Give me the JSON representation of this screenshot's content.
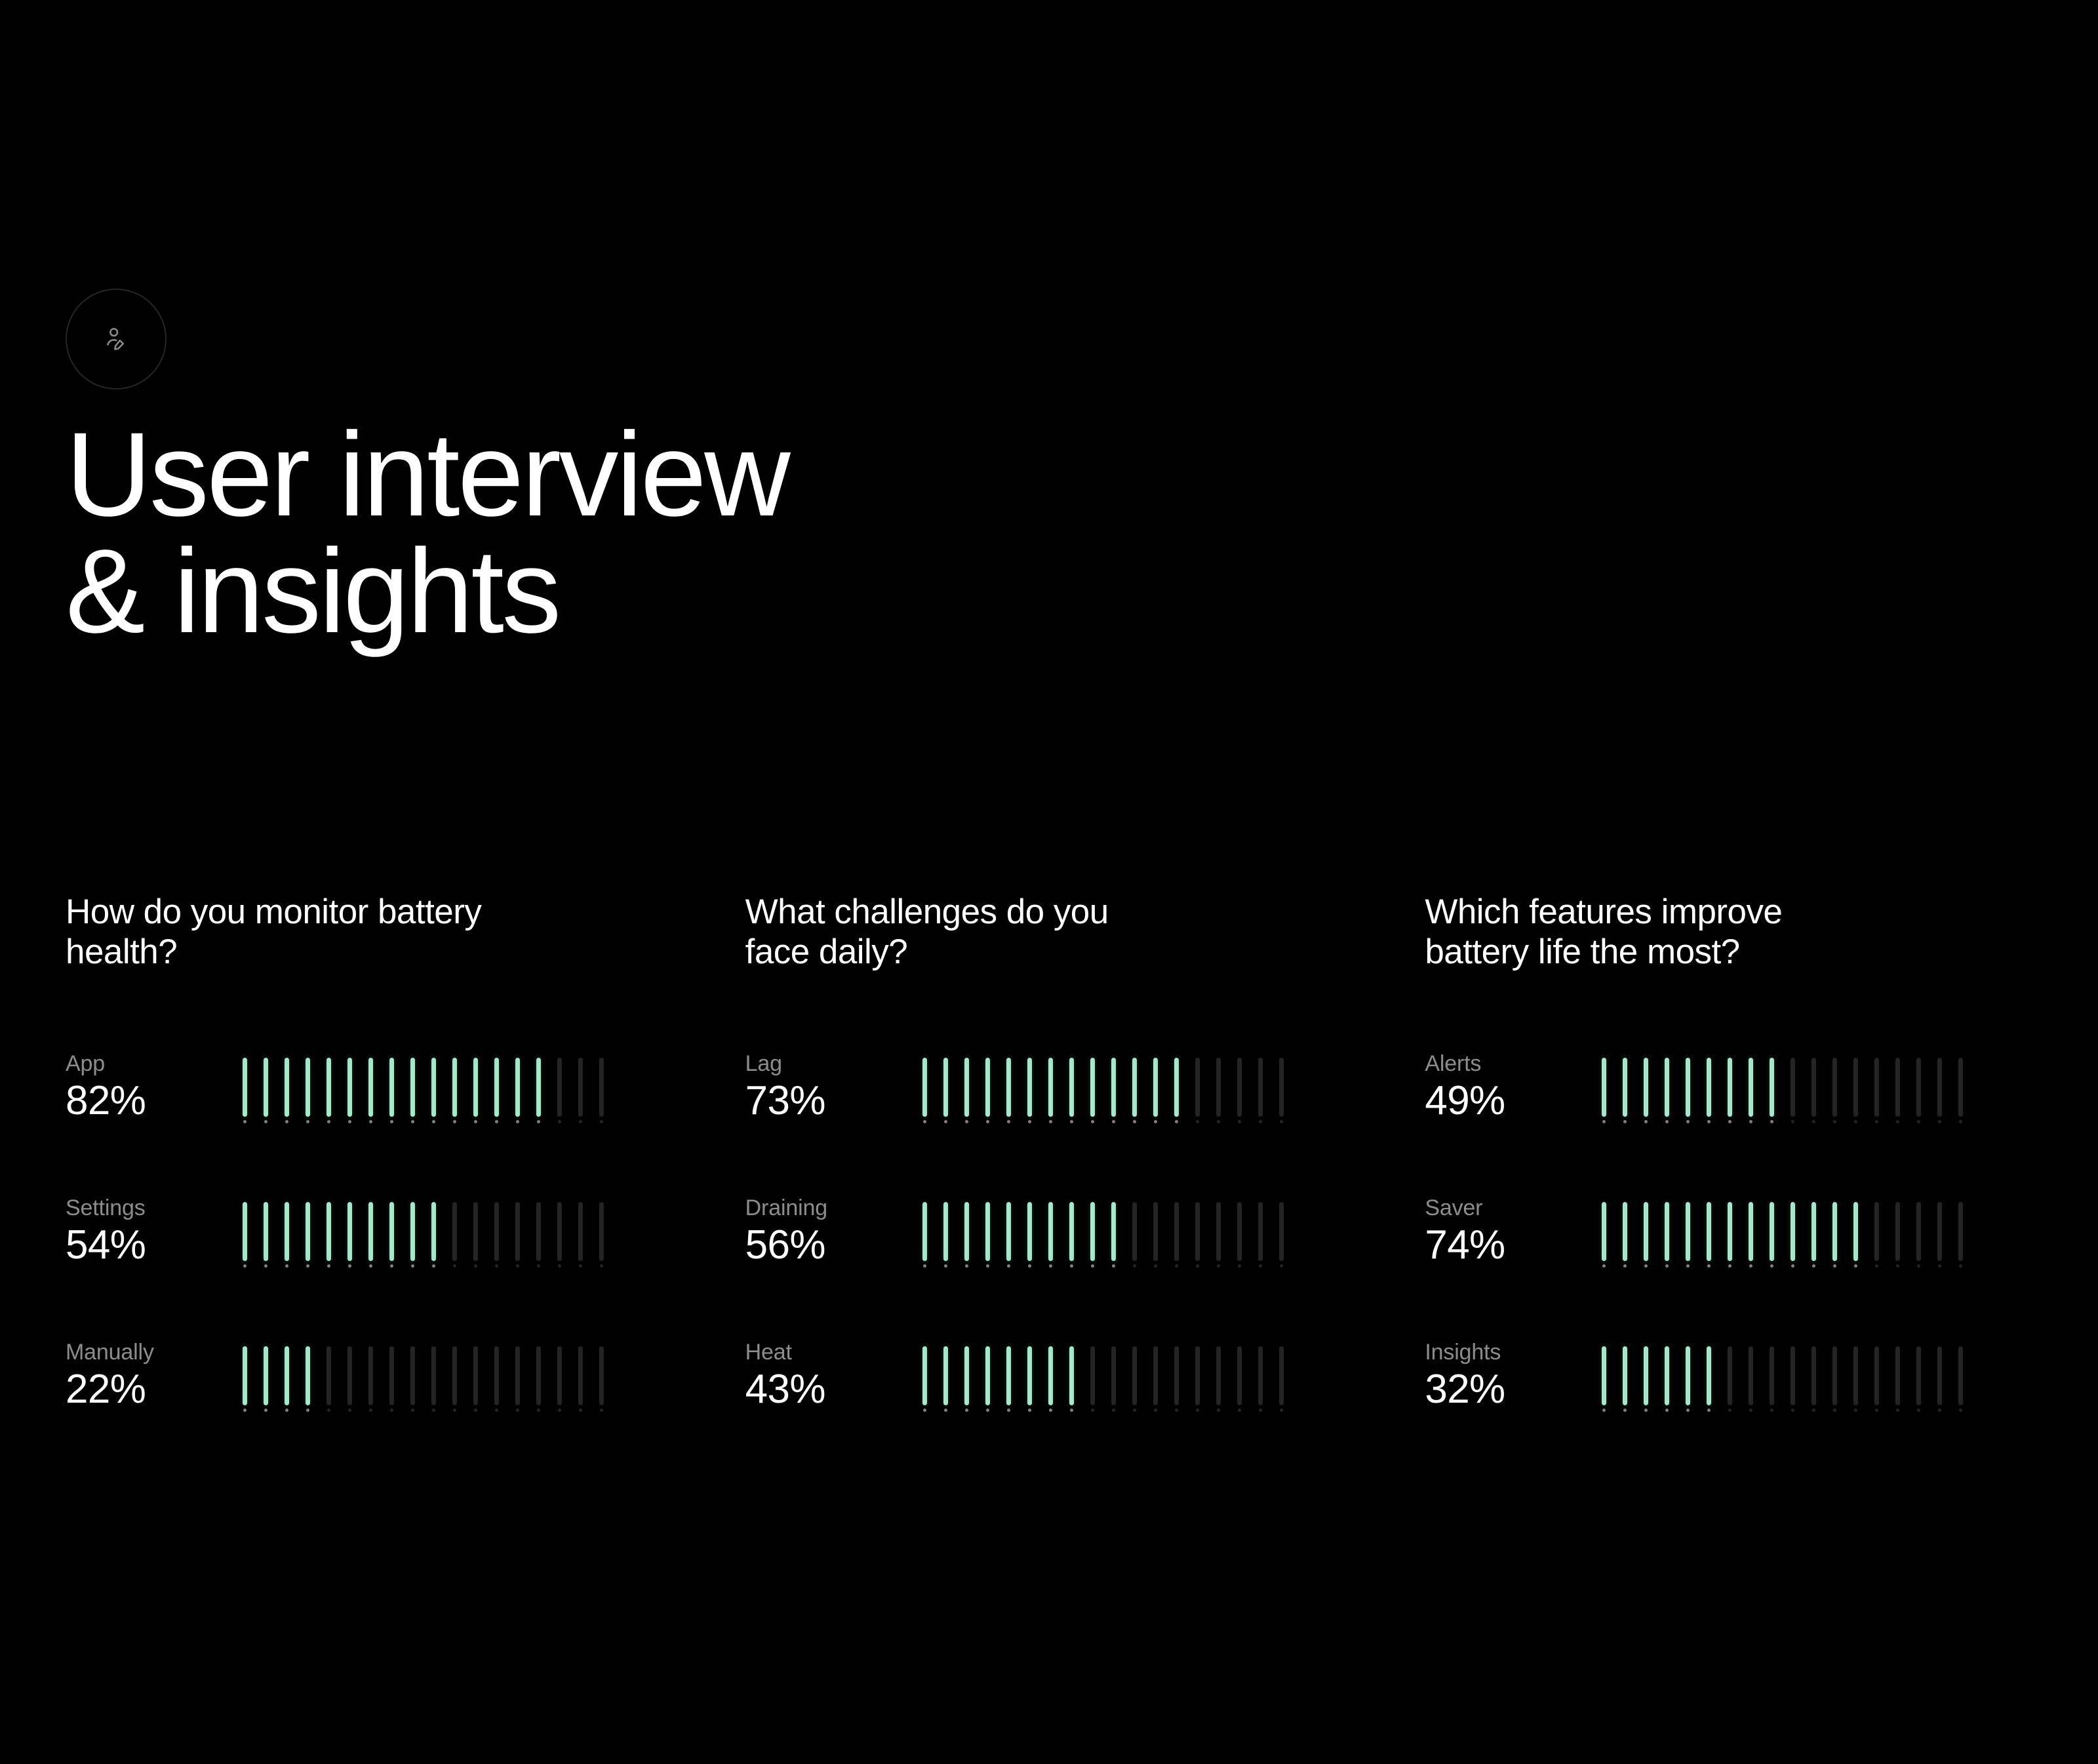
{
  "header": {
    "icon_name": "user-edit-icon",
    "title": "User interview\n& insights"
  },
  "colors": {
    "accent": "#a7e7c9",
    "muted_text": "rgba(255,255,255,0.55)",
    "inactive_bar": "rgba(255,255,255,0.14)",
    "background": "#000000"
  },
  "tally_total": 18,
  "columns": [
    {
      "heading": "How do you monitor battery health?",
      "metrics": [
        {
          "label": "App",
          "value": 82,
          "display": "82%",
          "filled": 15
        },
        {
          "label": "Settings",
          "value": 54,
          "display": "54%",
          "filled": 10
        },
        {
          "label": "Manually",
          "value": 22,
          "display": "22%",
          "filled": 4
        }
      ]
    },
    {
      "heading": "What challenges do you face daily?",
      "metrics": [
        {
          "label": "Lag",
          "value": 73,
          "display": "73%",
          "filled": 13
        },
        {
          "label": "Draining",
          "value": 56,
          "display": "56%",
          "filled": 10
        },
        {
          "label": "Heat",
          "value": 43,
          "display": "43%",
          "filled": 8
        }
      ]
    },
    {
      "heading": "Which features improve battery life the most?",
      "metrics": [
        {
          "label": "Alerts",
          "value": 49,
          "display": "49%",
          "filled": 9
        },
        {
          "label": "Saver",
          "value": 74,
          "display": "74%",
          "filled": 13
        },
        {
          "label": "Insights",
          "value": 32,
          "display": "32%",
          "filled": 6
        }
      ]
    }
  ],
  "chart_data": [
    {
      "type": "bar",
      "title": "How do you monitor battery health?",
      "categories": [
        "App",
        "Settings",
        "Manually"
      ],
      "values": [
        82,
        54,
        22
      ],
      "ylim": [
        0,
        100
      ],
      "ylabel": "%",
      "orientation": "tally-bars"
    },
    {
      "type": "bar",
      "title": "What challenges do you face daily?",
      "categories": [
        "Lag",
        "Draining",
        "Heat"
      ],
      "values": [
        73,
        56,
        43
      ],
      "ylim": [
        0,
        100
      ],
      "ylabel": "%",
      "orientation": "tally-bars"
    },
    {
      "type": "bar",
      "title": "Which features improve battery life the most?",
      "categories": [
        "Alerts",
        "Saver",
        "Insights"
      ],
      "values": [
        49,
        74,
        32
      ],
      "ylim": [
        0,
        100
      ],
      "ylabel": "%",
      "orientation": "tally-bars"
    }
  ]
}
